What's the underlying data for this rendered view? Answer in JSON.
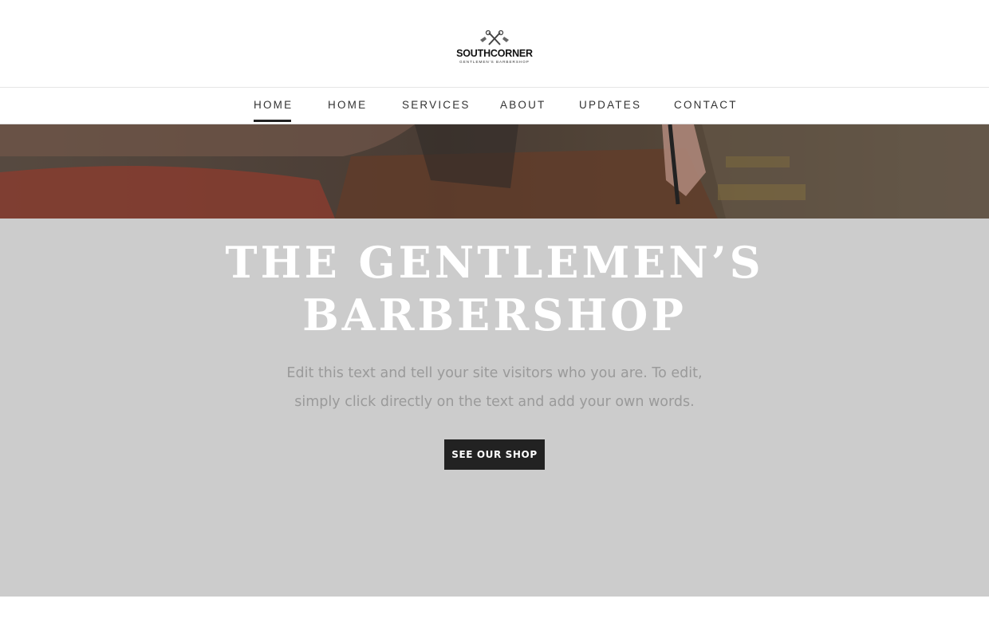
{
  "logo": {
    "name": "SOUTHCORNER",
    "tagline": "GENTLEMEN'S BARBERSHOP"
  },
  "nav": {
    "items": [
      {
        "label": "HOME",
        "active": true
      },
      {
        "label": "HOME",
        "active": false
      },
      {
        "label": "SERVICES",
        "active": false
      },
      {
        "label": "ABOUT",
        "active": false
      },
      {
        "label": "UPDATES",
        "active": false
      },
      {
        "label": "CONTACT",
        "active": false
      }
    ]
  },
  "hero": {
    "title_line1": "THE GENTLEMEN’S",
    "title_line2": "BARBERSHOP",
    "text_line1": "Edit this text and tell your site visitors who you are. To edit,",
    "text_line2": "simply click directly on the text and add your own words.",
    "button_label": "SEE OUR SHOP"
  },
  "colors": {
    "hero_background": "#cccccc",
    "button_background": "#222222",
    "accent_underline": "#222222"
  }
}
